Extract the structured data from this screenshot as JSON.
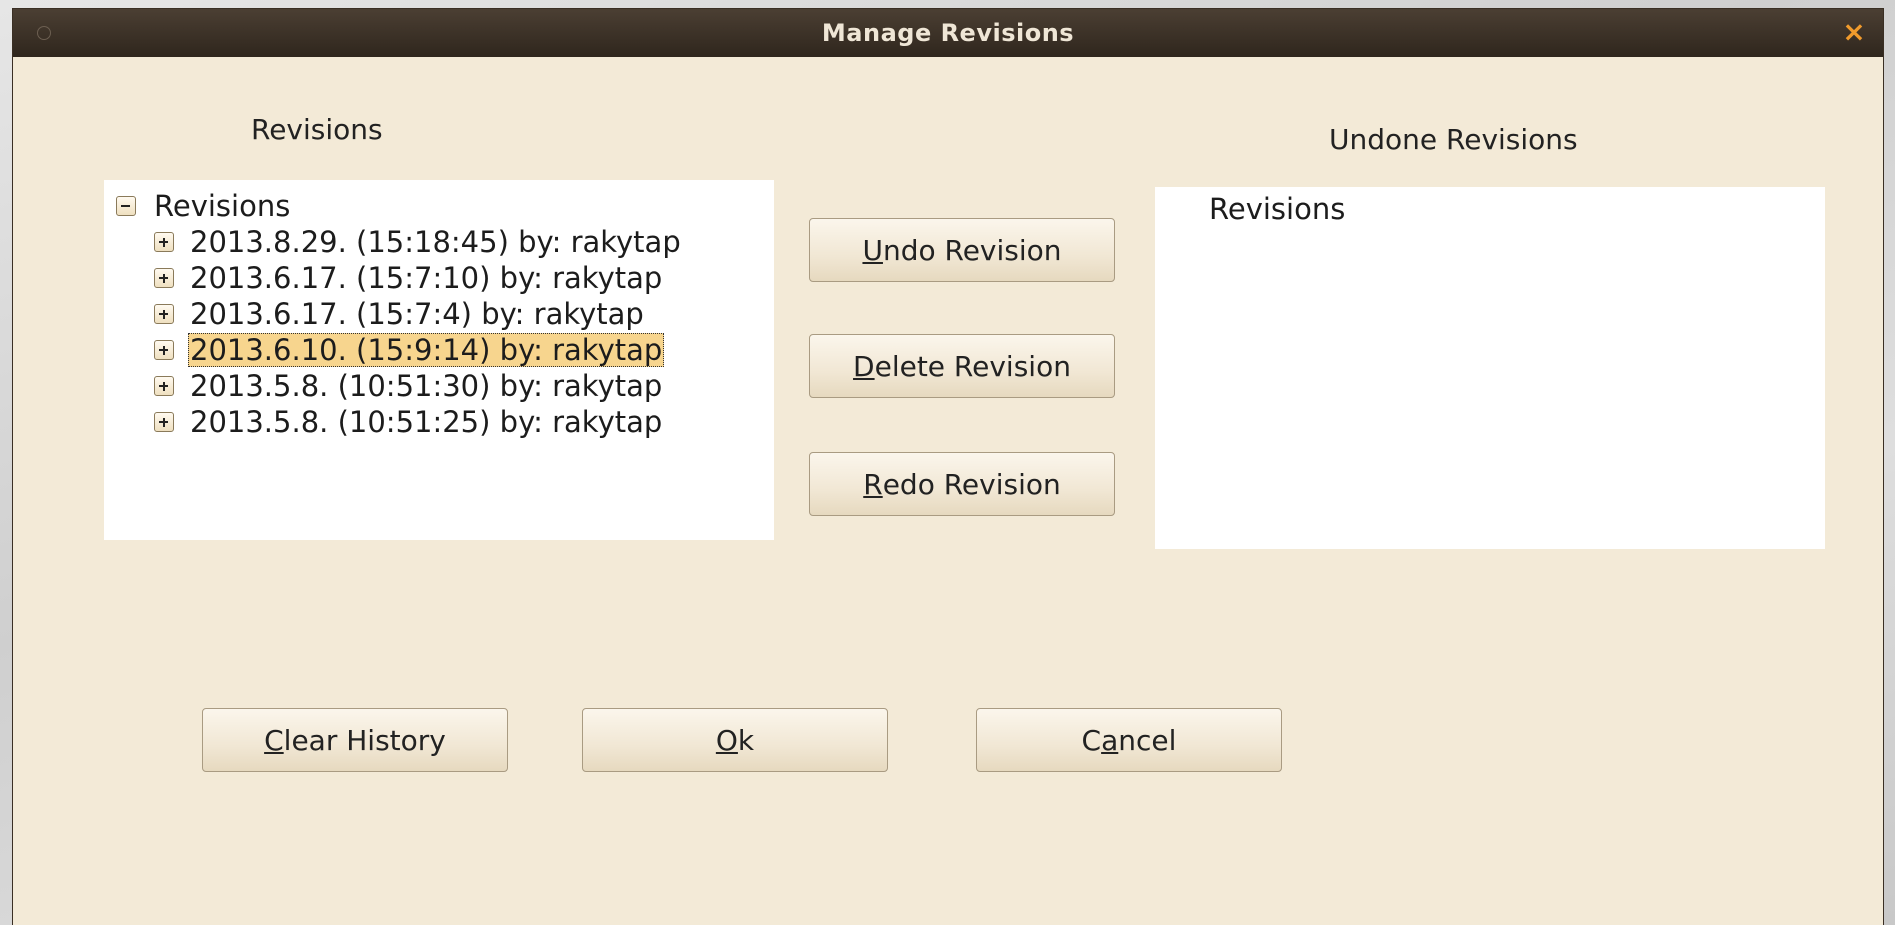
{
  "window": {
    "title": "Manage Revisions"
  },
  "revisions_panel": {
    "heading": "Revisions",
    "root_label": "Revisions",
    "items": [
      {
        "label": "2013.8.29.  (15:18:45) by: rakytap",
        "selected": false
      },
      {
        "label": "2013.6.17.  (15:7:10) by: rakytap",
        "selected": false
      },
      {
        "label": "2013.6.17.  (15:7:4) by: rakytap",
        "selected": false
      },
      {
        "label": "2013.6.10.  (15:9:14) by: rakytap",
        "selected": true
      },
      {
        "label": "2013.5.8.  (10:51:30) by: rakytap",
        "selected": false
      },
      {
        "label": "2013.5.8.  (10:51:25) by: rakytap",
        "selected": false
      }
    ]
  },
  "undone_panel": {
    "heading": "Undone Revisions",
    "root_label": "Revisions"
  },
  "buttons": {
    "undo": {
      "mnemonic": "U",
      "rest": "ndo Revision"
    },
    "delete": {
      "mnemonic": "D",
      "rest": "elete Revision"
    },
    "redo": {
      "mnemonic": "R",
      "rest": "edo Revision"
    },
    "clear": {
      "mnemonic": "C",
      "rest": "lear History"
    },
    "ok": {
      "mnemonic": "O",
      "rest": "k"
    },
    "cancel": {
      "pre": "C",
      "mnemonic": "a",
      "rest": "ncel"
    }
  },
  "colors": {
    "dialog_background": "#f3ead7",
    "titlebar": "#2f261d",
    "selection": "#f7d58e",
    "close_icon": "#f19b2c"
  },
  "icons": {
    "window_menu": "circle-icon",
    "close": "close-x-icon",
    "collapse": "minus-box-icon",
    "expand": "plus-box-icon"
  }
}
